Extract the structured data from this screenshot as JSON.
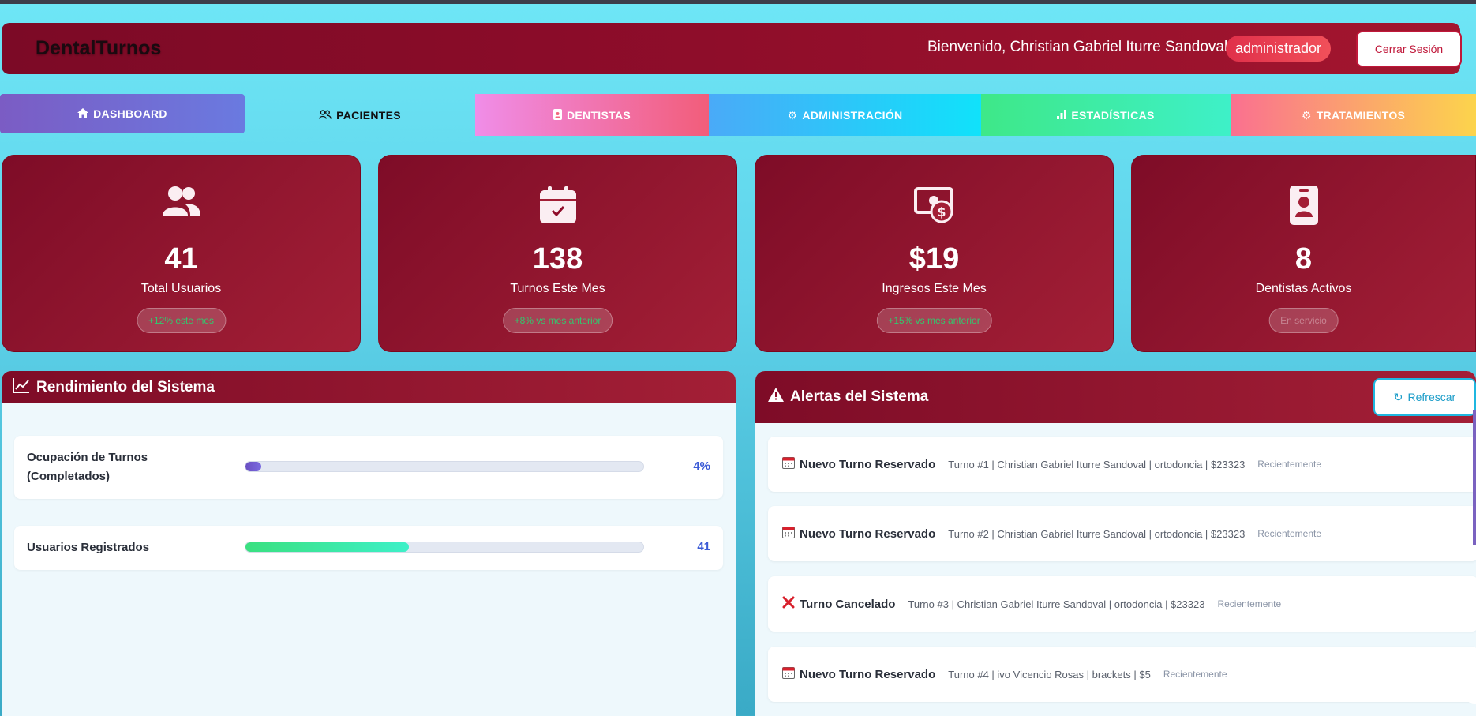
{
  "header": {
    "brand": "DentalTurnos",
    "welcome": "Bienvenido, Christian Gabriel Iturre Sandoval",
    "role": "administrador",
    "logout_label": "Cerrar Sesión"
  },
  "tabs": [
    {
      "label": "DASHBOARD",
      "icon": "home-icon"
    },
    {
      "label": "PACIENTES",
      "icon": "users-icon"
    },
    {
      "label": "DENTISTAS",
      "icon": "id-badge-icon"
    },
    {
      "label": "ADMINISTRACIÓN",
      "icon": "gear-icon"
    },
    {
      "label": "ESTADÍSTICAS",
      "icon": "bar-chart-icon"
    },
    {
      "label": "TRATAMIENTOS",
      "icon": "gear-icon"
    }
  ],
  "stats": [
    {
      "value": "41",
      "label": "Total Usuarios",
      "badge": "+12% este mes",
      "icon": "users-icon"
    },
    {
      "value": "138",
      "label": "Turnos Este Mes",
      "badge": "+8% vs mes anterior",
      "icon": "calendar-check-icon"
    },
    {
      "value": "$19",
      "label": "Ingresos Este Mes",
      "badge": "+15% vs mes anterior",
      "icon": "money-icon"
    },
    {
      "value": "8",
      "label": "Dentistas Activos",
      "badge": "En servicio",
      "icon": "id-badge-icon"
    }
  ],
  "performance": {
    "title": "Rendimiento del Sistema",
    "rows": [
      {
        "label_line1": "Ocupación de Turnos",
        "label_line2": "(Completados)",
        "value": "4%",
        "fill_percent": 4
      },
      {
        "label_line1": "Usuarios Registrados",
        "label_line2": "",
        "value": "41",
        "fill_percent": 41
      }
    ]
  },
  "alerts": {
    "title": "Alertas del Sistema",
    "refresh_label": "Refrescar",
    "items": [
      {
        "icon": "calendar-icon",
        "title": "Nuevo Turno Reservado",
        "detail": "Turno #1 | Christian Gabriel Iturre Sandoval | ortodoncia | $23323",
        "time": "Recientemente"
      },
      {
        "icon": "calendar-icon",
        "title": "Nuevo Turno Reservado",
        "detail": "Turno #2 | Christian Gabriel Iturre Sandoval | ortodoncia | $23323",
        "time": "Recientemente"
      },
      {
        "icon": "cross-icon",
        "title": "Turno Cancelado",
        "detail": "Turno #3 | Christian Gabriel Iturre Sandoval | ortodoncia | $23323",
        "time": "Recientemente"
      },
      {
        "icon": "calendar-icon",
        "title": "Nuevo Turno Reservado",
        "detail": "Turno #4 | ivo Vicencio Rosas | brackets | $5",
        "time": "Recientemente"
      }
    ]
  },
  "colors": {
    "primary": "#8f0d2a",
    "accent_blue": "#3a5ad6",
    "refresh": "#1fb7e0"
  }
}
